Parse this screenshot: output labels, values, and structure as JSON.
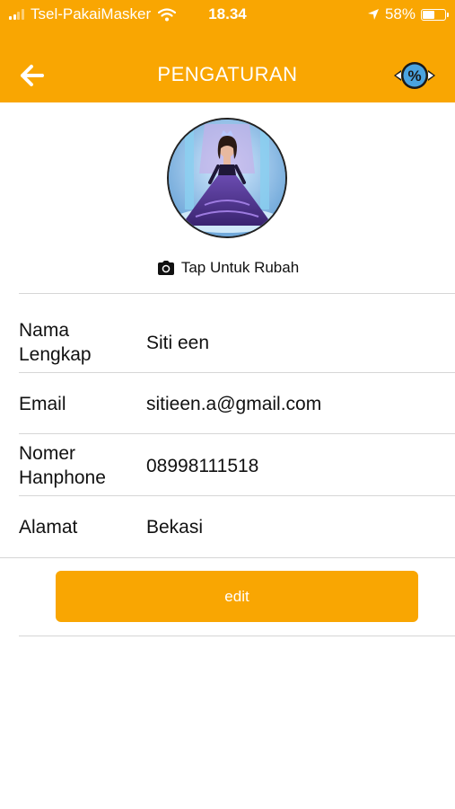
{
  "status_bar": {
    "carrier": "Tsel-PakaiMasker",
    "time": "18.34",
    "battery": "58%",
    "battery_level": 0.58,
    "icons": [
      "signal-bars-icon",
      "wifi-icon",
      "location-arrow-icon",
      "battery-icon"
    ]
  },
  "header": {
    "title": "PENGATURAN",
    "back_icon": "arrow-left-icon",
    "right_icon": "percent-promo-icon"
  },
  "profile": {
    "avatar": "profile-photo",
    "change_photo_icon": "camera-icon",
    "change_photo_label": "Tap Untuk Rubah"
  },
  "fields": [
    {
      "label_line1": "Nama",
      "label_line2": "Lengkap",
      "value": "Siti een"
    },
    {
      "label": "Email",
      "value": "sitieen.a@gmail.com"
    },
    {
      "label_line1": "Nomer",
      "label_line2": "Hanphone",
      "value": "08998111518"
    },
    {
      "label": "Alamat",
      "value": "Bekasi"
    }
  ],
  "actions": {
    "edit_label": "edit"
  },
  "colors": {
    "accent": "#f9a602",
    "text": "#111111",
    "divider": "#d6d6d6"
  }
}
